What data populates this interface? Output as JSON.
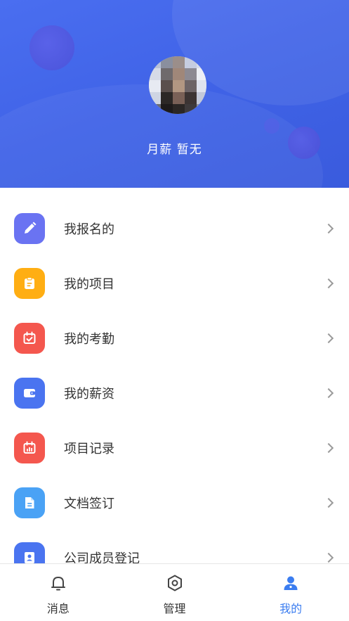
{
  "profile": {
    "name": "月薪 暂无"
  },
  "colors": {
    "header_bg": "#4166e8",
    "accent": "#3b7df0"
  },
  "menu": {
    "items": [
      {
        "label": "我报名的",
        "icon": "pencil-icon",
        "color": "#6a73f2"
      },
      {
        "label": "我的项目",
        "icon": "clipboard-icon",
        "color": "#ffae13"
      },
      {
        "label": "我的考勤",
        "icon": "calendar-check-icon",
        "color": "#f4574e"
      },
      {
        "label": "我的薪资",
        "icon": "wallet-icon",
        "color": "#4a74f0"
      },
      {
        "label": "项目记录",
        "icon": "bar-chart-calendar-icon",
        "color": "#f4574e"
      },
      {
        "label": "文档签订",
        "icon": "document-icon",
        "color": "#4aa2f5"
      },
      {
        "label": "公司成员登记",
        "icon": "id-card-icon",
        "color": "#4a74f0"
      }
    ]
  },
  "tabbar": {
    "tabs": [
      {
        "label": "消息",
        "icon": "bell-icon",
        "active": false
      },
      {
        "label": "管理",
        "icon": "hexagon-icon",
        "active": false
      },
      {
        "label": "我的",
        "icon": "user-icon",
        "active": true
      }
    ]
  }
}
